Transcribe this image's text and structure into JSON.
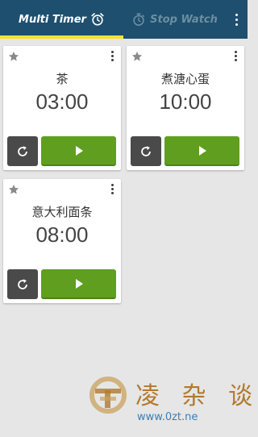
{
  "tabs": [
    {
      "label": "Multi Timer",
      "icon": "alarm-clock-icon",
      "active": true
    },
    {
      "label": "Stop Watch",
      "icon": "stopwatch-icon",
      "active": false
    }
  ],
  "colors": {
    "topbar": "#1e4f6e",
    "indicator": "#f2e233",
    "play": "#5f9e1e",
    "reset": "#4a4a4a"
  },
  "timers": [
    {
      "name": "茶",
      "time": "03:00"
    },
    {
      "name": "煮溏心蛋",
      "time": "10:00"
    },
    {
      "name": "意大利面条",
      "time": "08:00"
    }
  ],
  "watermark": {
    "text": "凌 杂 谈",
    "url": "www.0zt.ne"
  }
}
